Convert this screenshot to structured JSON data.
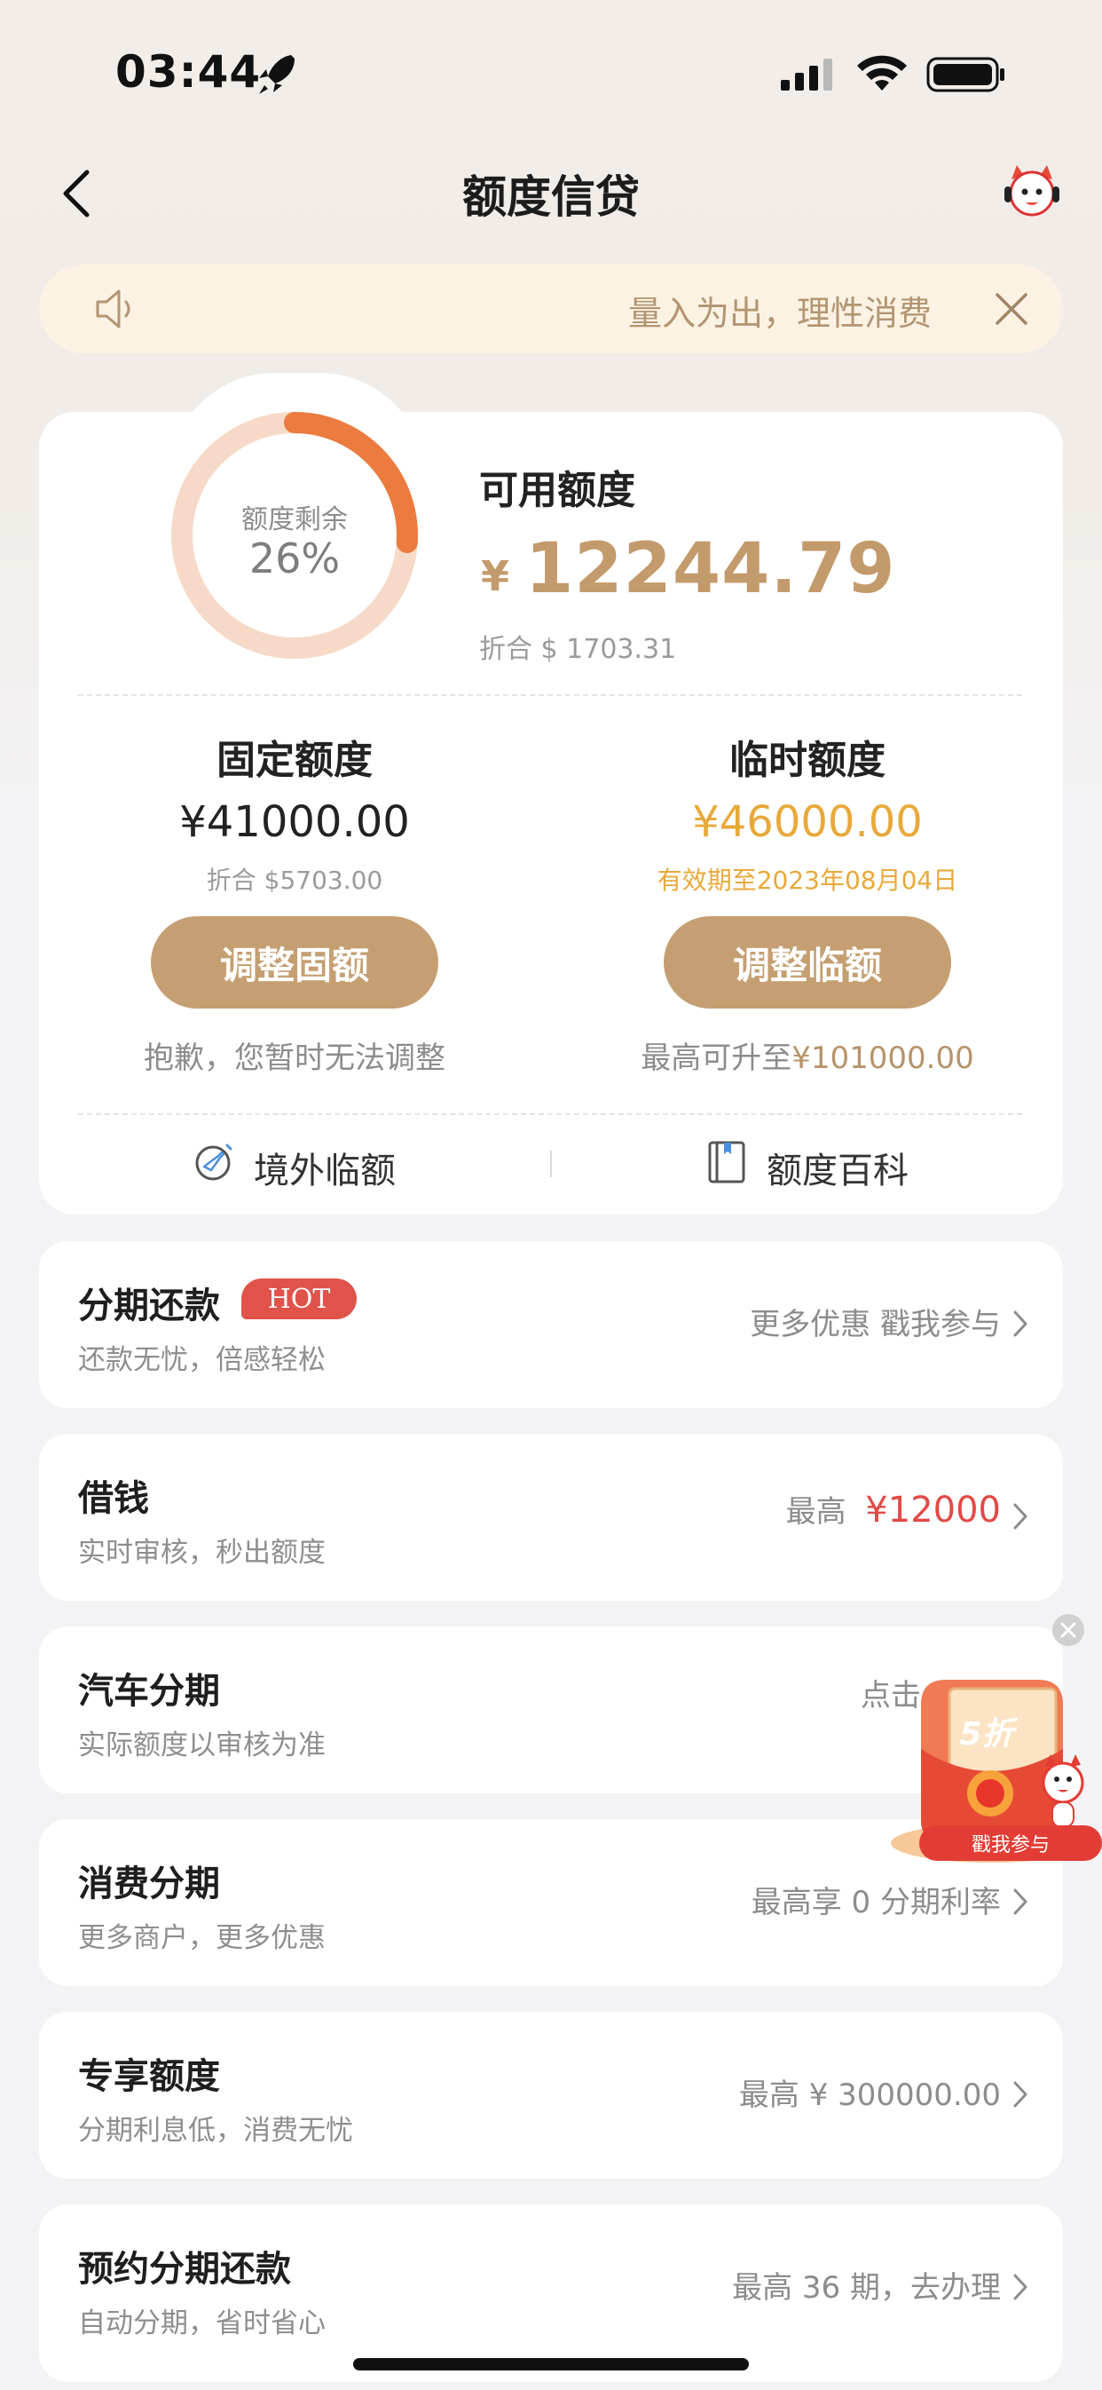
{
  "status_bar": {
    "time": "03:44"
  },
  "nav": {
    "title": "额度信贷"
  },
  "notice": {
    "text": "量入为出，理性消费"
  },
  "credit": {
    "ring_label": "额度剩余",
    "ring_percent_text": "26%",
    "remaining_fraction": 0.26,
    "available_label": "可用额度",
    "currency_symbol": "¥",
    "available_amount": "12244.79",
    "available_converted": "折合 $ 1703.31"
  },
  "fixed": {
    "title": "固定额度",
    "amount": "¥41000.00",
    "converted": "折合 $5703.00",
    "button": "调整固额",
    "note": "抱歉，您暂时无法调整"
  },
  "temporary": {
    "title": "临时额度",
    "amount": "¥46000.00",
    "validity": "有效期至2023年08月04日",
    "button": "调整临额",
    "note_prefix": "最高可升至",
    "note_amount": "¥101000.00"
  },
  "links": {
    "overseas": "境外临额",
    "encyclopedia": "额度百科"
  },
  "items": [
    {
      "title": "分期还款",
      "badge": "HOT",
      "subtitle": "还款无忧，倍感轻松",
      "right": "更多优惠 戳我参与"
    },
    {
      "title": "借钱",
      "subtitle": "实时审核，秒出额度",
      "right_prefix": "最高",
      "right_amount": "¥12000"
    },
    {
      "title": "汽车分期",
      "subtitle": "实际额度以审核为准",
      "right": "点击"
    },
    {
      "title": "消费分期",
      "subtitle": "更多商户，更多优惠",
      "right": "最高享 0 分期利率"
    },
    {
      "title": "专享额度",
      "subtitle": "分期利息低，消费无忧",
      "right": "最高 ¥ 300000.00"
    },
    {
      "title": "预约分期还款",
      "subtitle": "自动分期，省时省心",
      "right": "最高 36 期，去办理"
    }
  ],
  "promo": {
    "discount": "5折",
    "cta": "戳我参与"
  },
  "colors": {
    "gold": "#c59f72",
    "amber": "#e8a93a",
    "red": "#e24a46",
    "ring_fill": "#ec7b3f",
    "ring_track": "#f7d9c8"
  }
}
